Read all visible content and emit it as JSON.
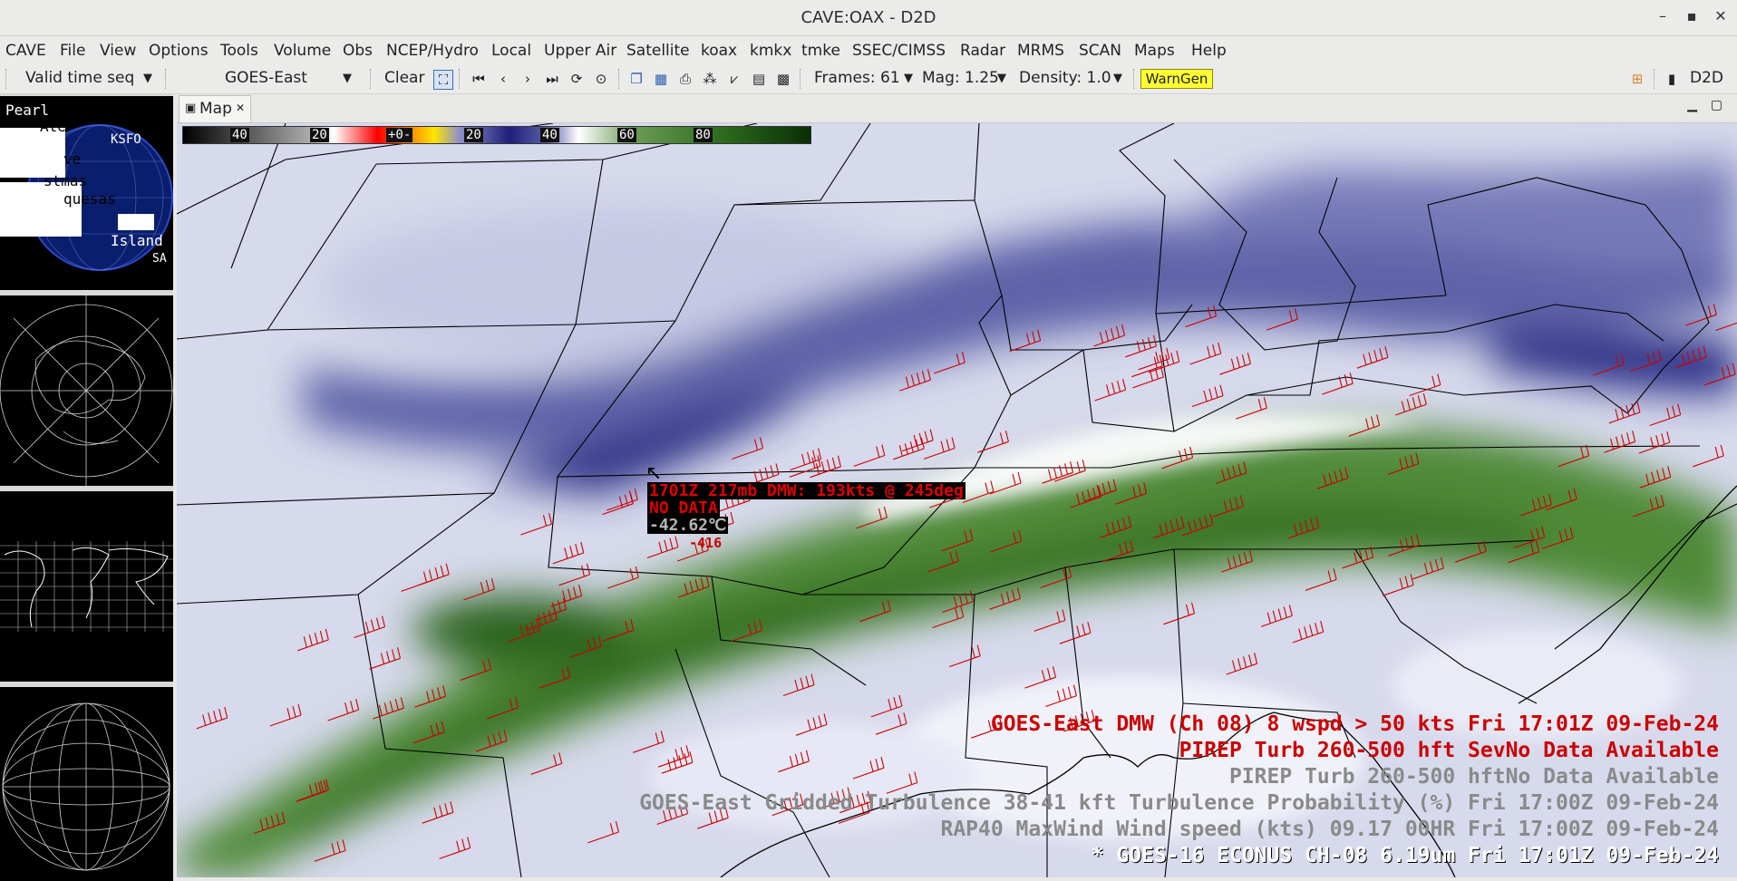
{
  "window": {
    "title": "CAVE:OAX - D2D",
    "controls": [
      "–",
      "▪",
      "✕"
    ]
  },
  "menu": [
    "CAVE",
    "File",
    "View",
    "Options",
    "Tools",
    "Volume",
    "Obs",
    "NCEP/Hydro",
    "Local",
    "Upper Air",
    "Satellite",
    "koax",
    "kmkx",
    "tmke",
    "SSEC/CIMSS",
    "Radar",
    "MRMS",
    "SCAN",
    "Maps",
    "Help"
  ],
  "toolbar": {
    "time_mode": "Valid time seq",
    "source": "GOES-East",
    "clear_label": "Clear",
    "frames": "Frames: 61",
    "mag": "Mag: 1.25",
    "density": "Density: 1.0",
    "warngen_label": "WarnGen",
    "perspective": "D2D"
  },
  "tab": {
    "label": "Map"
  },
  "colorbar": {
    "labels": [
      "40",
      "20",
      "+0-",
      "20",
      "40",
      "60",
      "80"
    ]
  },
  "sample_readout": {
    "line1": "1701Z 217mb DMW: 193kts @ 245deg",
    "line2": "NO DATA",
    "line3": "-42.62℃",
    "extra": "-416"
  },
  "legend": [
    {
      "text": "GOES-East DMW (Ch 08) 8 wspd > 50 kts  Fri 17:01Z 09-Feb-24",
      "color": "#cc0000"
    },
    {
      "text": "PIREP Turb 260-500 hft SevNo Data Available",
      "color": "#cc0000"
    },
    {
      "text": "PIREP Turb 260-500 hftNo Data Available",
      "color": "#8a8a8a"
    },
    {
      "text": "GOES-East Gridded Turbulence 38-41 kft Turbulence Probability  (%)   Fri 17:00Z 09-Feb-24",
      "color": "#8a8a8a"
    },
    {
      "text": "RAP40 MaxWind Wind speed  (kts)    09.17   00HR Fri 17:00Z 09-Feb-24",
      "color": "#8a8a8a"
    },
    {
      "text": "* GOES-16 ECONUS CH-08 6.19um   Fri 17:01Z 09-Feb-24",
      "color": "#ffffff"
    }
  ],
  "thumbnail_labels": [
    "Pearl",
    "Ate",
    "KSFO",
    "ve",
    "stmas",
    "quesas",
    "Island",
    "SA"
  ],
  "colors": {
    "barb": "#cc0000",
    "map_line": "#000000"
  }
}
